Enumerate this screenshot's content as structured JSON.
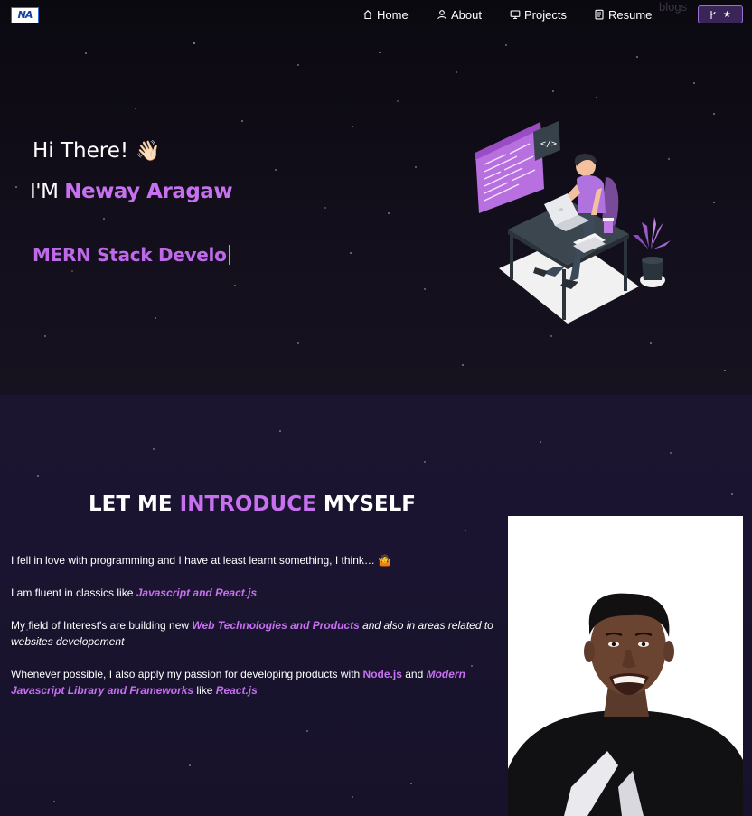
{
  "navbar": {
    "logo_text": "NA",
    "items": [
      {
        "label": "Home",
        "icon": "home-icon"
      },
      {
        "label": "About",
        "icon": "user-icon"
      },
      {
        "label": "Projects",
        "icon": "monitor-icon"
      },
      {
        "label": "Resume",
        "icon": "document-icon"
      }
    ],
    "blogs_label": "blogs",
    "fork_button": {
      "icon": "git-branch-icon",
      "star_icon": "star-icon"
    }
  },
  "hero": {
    "greeting": "Hi There!",
    "wave_emoji": "👋🏻",
    "intro_prefix": "I'M",
    "name": "Neway Aragaw",
    "typewriter_text": "MERN Stack Develo"
  },
  "about": {
    "title_prefix": "LET ME",
    "title_highlight": "INTRODUCE",
    "title_suffix": "MYSELF",
    "p1": "I fell in love with programming and I have at least learnt something, I think… 🤷",
    "p2_text": "I am fluent in classics like ",
    "p2_highlight": "Javascript and React.js",
    "p3_text": "My field of Interest's are building new ",
    "p3_highlight": "Web Technologies and Products",
    "p3_tail": " and also in areas related to websites developement",
    "p4_text": "Whenever possible, I also apply my passion for developing products with ",
    "p4_node": "Node.js",
    "p4_and": " and ",
    "p4_highlight": "Modern Javascript Library and Frameworks",
    "p4_like": "  like ",
    "p4_react": "React.js"
  },
  "colors": {
    "accent": "#c770f0",
    "background_top": "#0e0b16",
    "background_about": "#1a1430"
  }
}
